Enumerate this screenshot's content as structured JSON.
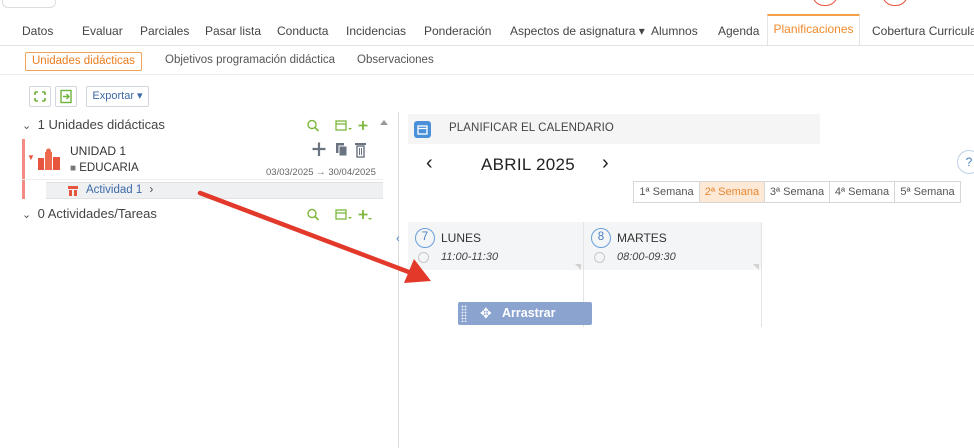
{
  "main_tabs": [
    {
      "label": "Datos"
    },
    {
      "label": "Evaluar"
    },
    {
      "label": "Parciales"
    },
    {
      "label": "Pasar lista"
    },
    {
      "label": "Conducta"
    },
    {
      "label": "Incidencias"
    },
    {
      "label": "Ponderación"
    },
    {
      "label": "Aspectos de asignatura ▾"
    },
    {
      "label": "Alumnos"
    },
    {
      "label": "Agenda"
    },
    {
      "label": "Planificaciones"
    },
    {
      "label": "Cobertura Curricular ▾"
    }
  ],
  "sub_tabs": [
    {
      "label": "Unidades didácticas"
    },
    {
      "label": "Objetivos programación didáctica"
    },
    {
      "label": "Observaciones"
    }
  ],
  "toolbar": {
    "export_label": "Exportar ▾"
  },
  "tree": {
    "units_header": "1 Unidades didácticas",
    "unit": {
      "title": "UNIDAD 1",
      "owner": "EDUCARIA",
      "dates": "03/03/2025 → 30/04/2025"
    },
    "activity": {
      "label": "Actividad 1",
      "chevron": "›"
    },
    "tasks_header": "0 Actividades/Tareas"
  },
  "calendar": {
    "title": "PLANIFICAR EL CALENDARIO",
    "month": "ABRIL 2025",
    "prev": "‹",
    "next": "›",
    "help": "?",
    "weeks": [
      "1ª Semana",
      "2ª Semana",
      "3ª Semana",
      "4ª Semana",
      "5ª Semana"
    ],
    "days": [
      {
        "num": "7",
        "name": "LUNES",
        "time": "11:00-11:30"
      },
      {
        "num": "8",
        "name": "MARTES",
        "time": "08:00-09:30"
      }
    ],
    "drag_label": "Arrastrar"
  },
  "colors": {
    "accent": "#f08a2c",
    "link_blue": "#3d6aa7",
    "green": "#7db83c",
    "arrow_red": "#e2392b"
  }
}
